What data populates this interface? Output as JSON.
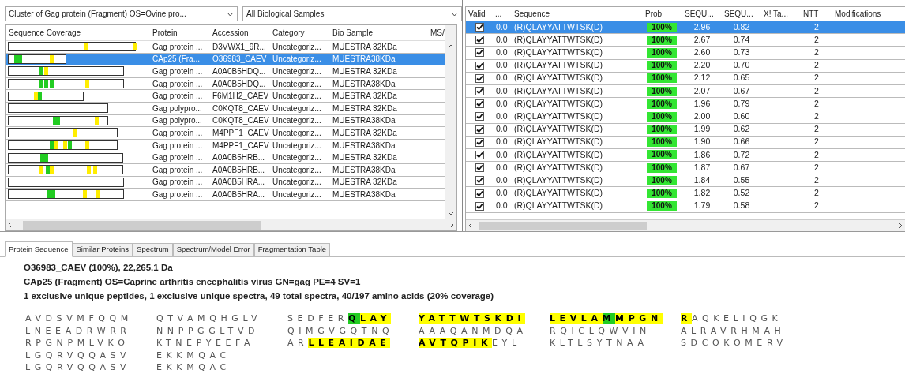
{
  "protein_panel": {
    "cluster_dropdown": "Cluster of Gag protein (Fragment) OS=Ovine pro...",
    "sample_dropdown": "All Biological Samples",
    "columns": [
      "Sequence Coverage",
      "Protein",
      "Accession",
      "Category",
      "Bio Sample",
      "MS/"
    ],
    "rows": [
      {
        "protein": "Gag protein ...",
        "accession": "D3VWX1_9R...",
        "category": "Uncategoriz...",
        "bio_sample": "MUESTRA 32KDa",
        "selected": false
      },
      {
        "protein": "CAp25 (Fra...",
        "accession": "O36983_CAEV",
        "category": "Uncategoriz...",
        "bio_sample": "MUESTRA38KDa",
        "selected": true
      },
      {
        "protein": "Gag protein ...",
        "accession": "A0A0B5HDQ...",
        "category": "Uncategoriz...",
        "bio_sample": "MUESTRA 32KDa",
        "selected": false
      },
      {
        "protein": "Gag protein ...",
        "accession": "A0A0B5HDQ...",
        "category": "Uncategoriz...",
        "bio_sample": "MUESTRA38KDa",
        "selected": false
      },
      {
        "protein": "Gag protein ...",
        "accession": "F6M1H2_CAEV",
        "category": "Uncategoriz...",
        "bio_sample": "MUESTRA 32KDa",
        "selected": false
      },
      {
        "protein": "Gag polypro...",
        "accession": "C0KQT8_CAEV",
        "category": "Uncategoriz...",
        "bio_sample": "MUESTRA 32KDa",
        "selected": false
      },
      {
        "protein": "Gag polypro...",
        "accession": "C0KQT8_CAEV",
        "category": "Uncategoriz...",
        "bio_sample": "MUESTRA38KDa",
        "selected": false
      },
      {
        "protein": "Gag protein ...",
        "accession": "M4PPF1_CAEV",
        "category": "Uncategoriz...",
        "bio_sample": "MUESTRA 32KDa",
        "selected": false
      },
      {
        "protein": "Gag protein ...",
        "accession": "M4PPF1_CAEV",
        "category": "Uncategoriz...",
        "bio_sample": "MUESTRA38KDa",
        "selected": false
      },
      {
        "protein": "Gag protein ...",
        "accession": "A0A0B5HRB...",
        "category": "Uncategoriz...",
        "bio_sample": "MUESTRA 32KDa",
        "selected": false
      },
      {
        "protein": "Gag protein ...",
        "accession": "A0A0B5HRB...",
        "category": "Uncategoriz...",
        "bio_sample": "MUESTRA38KDa",
        "selected": false
      },
      {
        "protein": "Gag protein ...",
        "accession": "A0A0B5HRA...",
        "category": "Uncategoriz...",
        "bio_sample": "MUESTRA 32KDa",
        "selected": false
      },
      {
        "protein": "Gag protein ...",
        "accession": "A0A0B5HRA...",
        "category": "Uncategoriz...",
        "bio_sample": "MUESTRA38KDa",
        "selected": false
      }
    ]
  },
  "spectrum_panel": {
    "columns": [
      "Valid",
      "...",
      "Sequence",
      "Prob",
      "SEQU...",
      "SEQU...",
      "X! Ta...",
      "NTT",
      "Modifications"
    ],
    "rows": [
      {
        "valid": true,
        "col_2": "0.0",
        "sequence": "(R)QLAYYATTWTSK(D)",
        "prob": {
          "text": "100%",
          "level": 1
        },
        "col_5": "2.96",
        "col_6": "0.82",
        "ntt": "2",
        "selected": true
      },
      {
        "valid": true,
        "col_2": "0.0",
        "sequence": "(R)QLAYYATTWTSK(D)",
        "prob": {
          "text": "100%",
          "level": 1
        },
        "col_5": "2.67",
        "col_6": "0.74",
        "ntt": "2",
        "selected": false
      },
      {
        "valid": true,
        "col_2": "0.0",
        "sequence": "(R)QLAYYATTWTSK(D)",
        "prob": {
          "text": "100%",
          "level": 1
        },
        "col_5": "2.60",
        "col_6": "0.73",
        "ntt": "2",
        "selected": false
      },
      {
        "valid": true,
        "col_2": "0.0",
        "sequence": "(R)QLAYYATTWTSK(D)",
        "prob": {
          "text": "100%",
          "level": 1
        },
        "col_5": "2.20",
        "col_6": "0.70",
        "ntt": "2",
        "selected": false
      },
      {
        "valid": true,
        "col_2": "0.0",
        "sequence": "(R)QLAYYATTWTSK(D)",
        "prob": {
          "text": "100%",
          "level": 1
        },
        "col_5": "2.12",
        "col_6": "0.65",
        "ntt": "2",
        "selected": false
      },
      {
        "valid": true,
        "col_2": "0.0",
        "sequence": "(R)QLAYYATTWTSK(D)",
        "prob": {
          "text": "100%",
          "level": 1
        },
        "col_5": "2.07",
        "col_6": "0.67",
        "ntt": "2",
        "selected": false
      },
      {
        "valid": true,
        "col_2": "0.0",
        "sequence": "(R)QLAYYATTWTSK(D)",
        "prob": {
          "text": "100%",
          "level": 1
        },
        "col_5": "1.96",
        "col_6": "0.79",
        "ntt": "2",
        "selected": false
      },
      {
        "valid": true,
        "col_2": "0.0",
        "sequence": "(R)QLAYYATTWTSK(D)",
        "prob": {
          "text": "100%",
          "level": 1
        },
        "col_5": "2.00",
        "col_6": "0.60",
        "ntt": "2",
        "selected": false
      },
      {
        "valid": true,
        "col_2": "0.0",
        "sequence": "(R)QLAYYATTWTSK(D)",
        "prob": {
          "text": "100%",
          "level": 1
        },
        "col_5": "1.99",
        "col_6": "0.62",
        "ntt": "2",
        "selected": false
      },
      {
        "valid": true,
        "col_2": "0.0",
        "sequence": "(R)QLAYYATTWTSK(D)",
        "prob": {
          "text": "100%",
          "level": 1
        },
        "col_5": "1.90",
        "col_6": "0.66",
        "ntt": "2",
        "selected": false
      },
      {
        "valid": true,
        "col_2": "0.0",
        "sequence": "(R)QLAYYATTWTSK(D)",
        "prob": {
          "text": "100%",
          "level": 1
        },
        "col_5": "1.86",
        "col_6": "0.72",
        "ntt": "2",
        "selected": false
      },
      {
        "valid": true,
        "col_2": "0.0",
        "sequence": "(R)QLAYYATTWTSK(D)",
        "prob": {
          "text": "100%",
          "level": 1
        },
        "col_5": "1.87",
        "col_6": "0.67",
        "ntt": "2",
        "selected": false
      },
      {
        "valid": true,
        "col_2": "0.0",
        "sequence": "(R)QLAYYATTWTSK(D)",
        "prob": {
          "text": "100%",
          "level": 1
        },
        "col_5": "1.84",
        "col_6": "0.55",
        "ntt": "2",
        "selected": false
      },
      {
        "valid": true,
        "col_2": "0.0",
        "sequence": "(R)QLAYYATTWTSK(D)",
        "prob": {
          "text": "100%",
          "level": 1
        },
        "col_5": "1.82",
        "col_6": "0.52",
        "ntt": "2",
        "selected": false
      },
      {
        "valid": true,
        "col_2": "0.0",
        "sequence": "(R)QLAYYATTWTSK(D)",
        "prob": {
          "text": "100%",
          "level": 1
        },
        "col_5": "1.79",
        "col_6": "0.58",
        "ntt": "2",
        "selected": false
      }
    ]
  },
  "tabs": [
    {
      "label": "Protein Sequence",
      "selected": true
    },
    {
      "label": "Similar Proteins",
      "selected": false
    },
    {
      "label": "Spectrum",
      "selected": false
    },
    {
      "label": "Spectrum/Model Error",
      "selected": false
    },
    {
      "label": "Fragmentation Table",
      "selected": false
    }
  ],
  "details": {
    "title": "O36983_CAEV (100%), 22,265.1 Da",
    "description": "CAp25 (Fragment) OS=Caprine arthritis encephalitis virus GN=gag PE=4 SV=1",
    "summary": "1 exclusive unique peptides, 1 exclusive unique spectra, 49 total spectra, 40/197 amino acids (20% coverage)",
    "sequence_lines": [
      [
        [
          {
            "text": "AVDSVMFQQM"
          }
        ],
        [
          {
            "text": "QTVAMQHGLV"
          }
        ],
        [
          {
            "text": "SEDFER"
          },
          {
            "text": "Q",
            "color": "#22cc22"
          },
          {
            "text": "LAY",
            "color": "#ffff00"
          }
        ],
        [
          {
            "text": "YATTWTSKDI",
            "color": "#ffff00"
          }
        ],
        [
          {
            "text": "LEVLA",
            "color": "#ffff00"
          },
          {
            "text": "M",
            "color": "#22cc22"
          },
          {
            "text": "MPGN",
            "color": "#ffff00"
          }
        ],
        [
          {
            "text": "R",
            "color": "#ffff00"
          },
          {
            "text": "AQKELIQGK"
          }
        ]
      ],
      [
        [
          {
            "text": "LNEEADRWRR"
          }
        ],
        [
          {
            "text": "NNPPGGLTVD"
          }
        ],
        [
          {
            "text": "QIMGVGQTNQ"
          }
        ],
        [
          {
            "text": "AAAQANMDQA"
          }
        ],
        [
          {
            "text": "RQICLQWVIN"
          }
        ],
        [
          {
            "text": "ALRAVRHMAH"
          }
        ]
      ],
      [
        [
          {
            "text": "RPGNPMLVKQ"
          }
        ],
        [
          {
            "text": "KTNEPYEEFA"
          }
        ],
        [
          {
            "text": "AR"
          },
          {
            "text": "LLEAIDAE",
            "color": "#ffff00"
          }
        ],
        [
          {
            "text": "AVTQPIK",
            "color": "#ffff00"
          },
          {
            "text": "EYL"
          }
        ],
        [
          {
            "text": "KLTLSYTNAA"
          }
        ],
        [
          {
            "text": "SDCQKQMERV"
          }
        ]
      ],
      [
        [
          {
            "text": "LGQRVQQASV"
          }
        ],
        [
          {
            "text": "EKKMQAC"
          }
        ]
      ],
      [
        [
          {
            "text": "LGQRVQQASV"
          }
        ],
        [
          {
            "text": "EKKMQAC"
          }
        ]
      ]
    ]
  }
}
